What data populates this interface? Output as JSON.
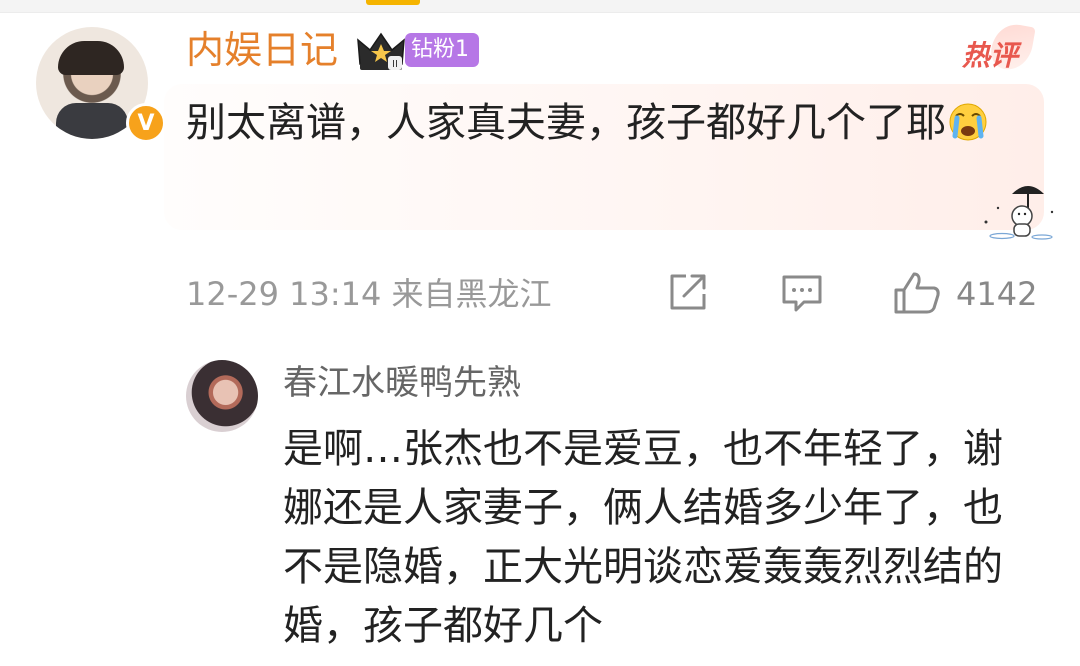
{
  "comment": {
    "username": "内娱日记",
    "fan_badge": "钻粉1",
    "hot_tag": "热评",
    "text": "别太离谱，人家真夫妻，孩子都好几个了耶",
    "timestamp": "12-29 13:14 来自黑龙江",
    "like_count": "4142",
    "verified_mark": "V"
  },
  "reply": {
    "username": "春江水暖鸭先熟",
    "text": "是啊…张杰也不是爱豆，也不年轻了，谢娜还是人家妻子，俩人结婚多少年了，也不是隐婚，正大光明谈恋爱轰轰烈烈结的婚，孩子都好几个"
  },
  "colors": {
    "username": "#e5802b",
    "fan_badge": "#b677e6",
    "hot_tag": "#e8584e",
    "verified": "#f7a21b",
    "meta_text": "#999999"
  },
  "icons": {
    "crown": "crown-level-icon",
    "share": "share-icon",
    "comment": "comment-icon",
    "like": "thumbs-up-icon",
    "emoji": "crying-face-emoji"
  }
}
